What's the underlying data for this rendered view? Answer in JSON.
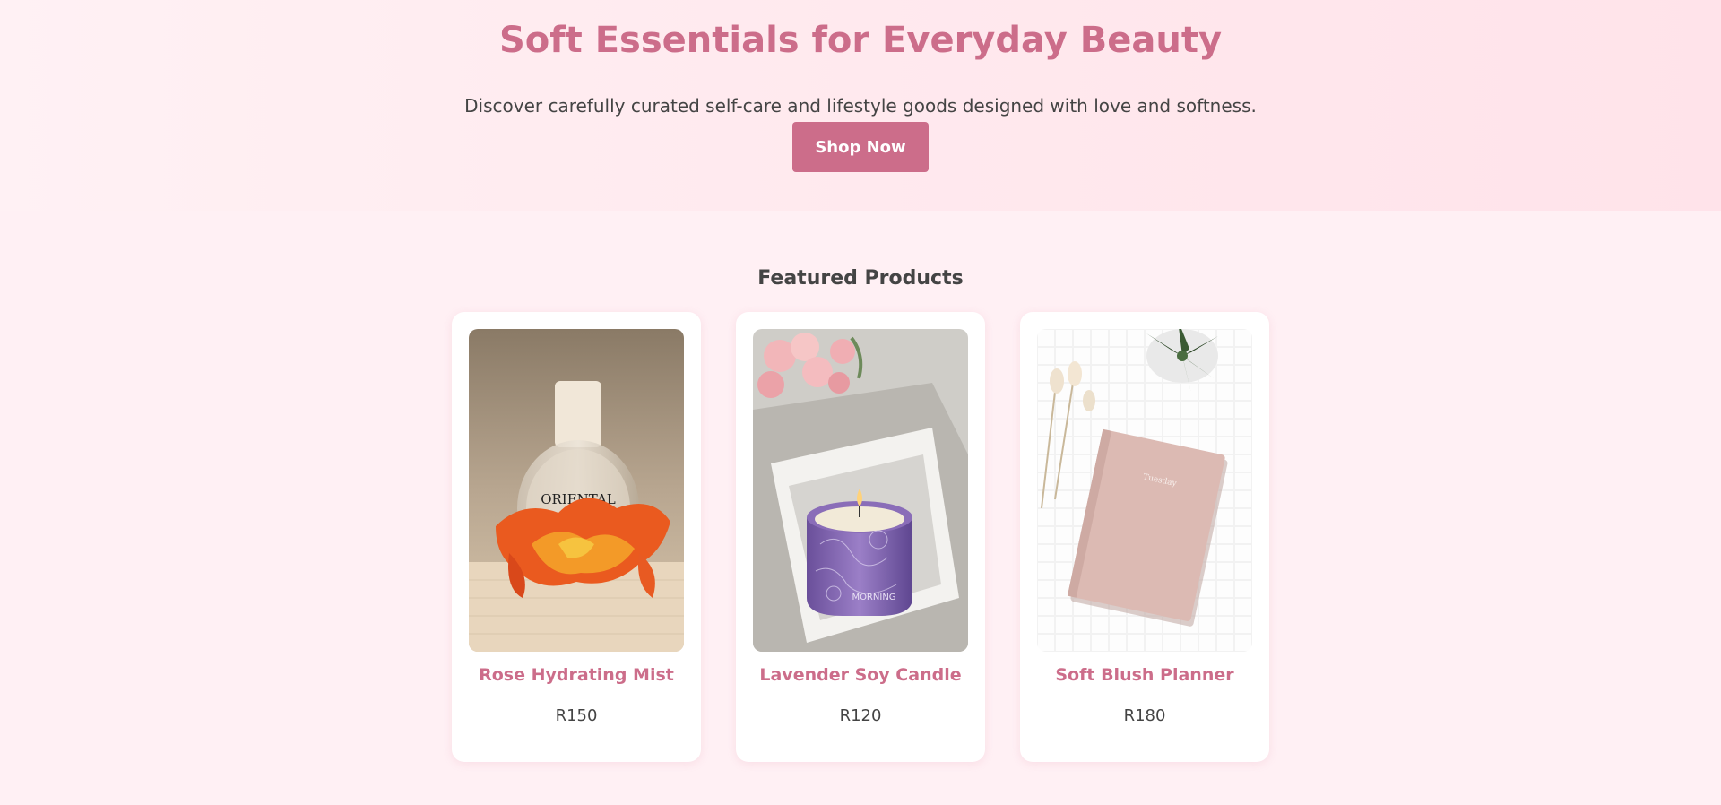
{
  "hero": {
    "title": "Soft Essentials for Everyday Beauty",
    "subtitle": "Discover carefully curated self-care and lifestyle goods designed with love and softness.",
    "button_label": "Shop Now"
  },
  "featured": {
    "title": "Featured Products",
    "products": [
      {
        "name": "Rose Hydrating Mist",
        "price": "R150",
        "image": "perfume-bottle-with-rose-petals",
        "bottle_label": "ORIENTAL"
      },
      {
        "name": "Lavender Soy Candle",
        "price": "R120",
        "image": "lavender-candle-in-glass",
        "candle_label": "MORNING"
      },
      {
        "name": "Soft Blush Planner",
        "price": "R180",
        "image": "pink-planner-on-tiles",
        "planner_label": "Tuesday"
      }
    ]
  },
  "colors": {
    "accent": "#cc6d8a",
    "background": "#fff0f4",
    "text": "#444444"
  }
}
